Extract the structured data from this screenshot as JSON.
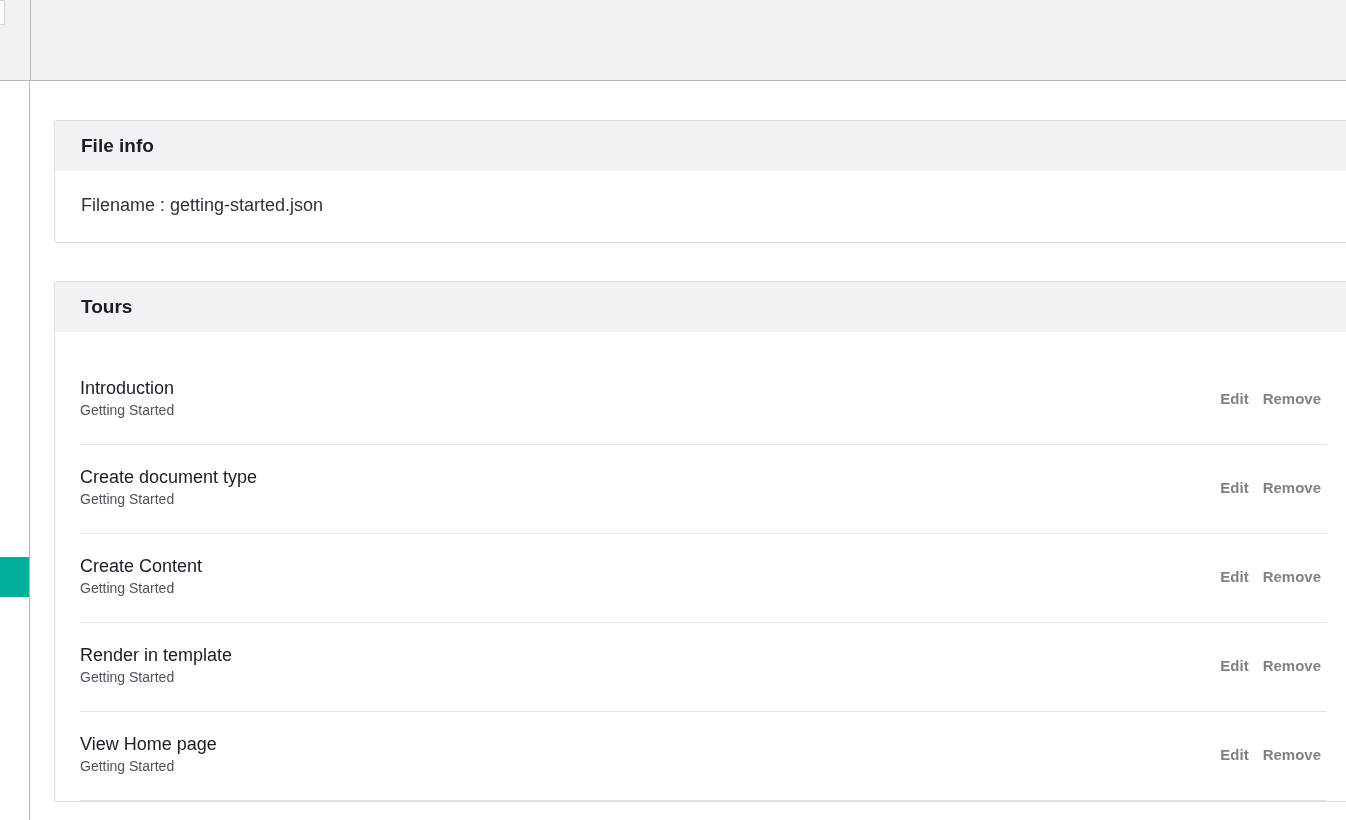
{
  "file_info": {
    "title": "File info",
    "filename": "Filename : getting-started.json"
  },
  "tours": {
    "title": "Tours",
    "items": [
      {
        "name": "Introduction",
        "group": "Getting Started",
        "actions": [
          "Edit",
          "Remove"
        ]
      },
      {
        "name": "Create document type",
        "group": "Getting Started",
        "actions": [
          "Edit",
          "Remove"
        ]
      },
      {
        "name": "Create Content",
        "group": "Getting Started",
        "actions": [
          "Edit",
          "Remove"
        ]
      },
      {
        "name": "Render in template",
        "group": "Getting Started",
        "actions": [
          "Edit",
          "Remove"
        ]
      },
      {
        "name": "View Home page",
        "group": "Getting Started",
        "actions": [
          "Edit",
          "Remove"
        ]
      }
    ]
  }
}
